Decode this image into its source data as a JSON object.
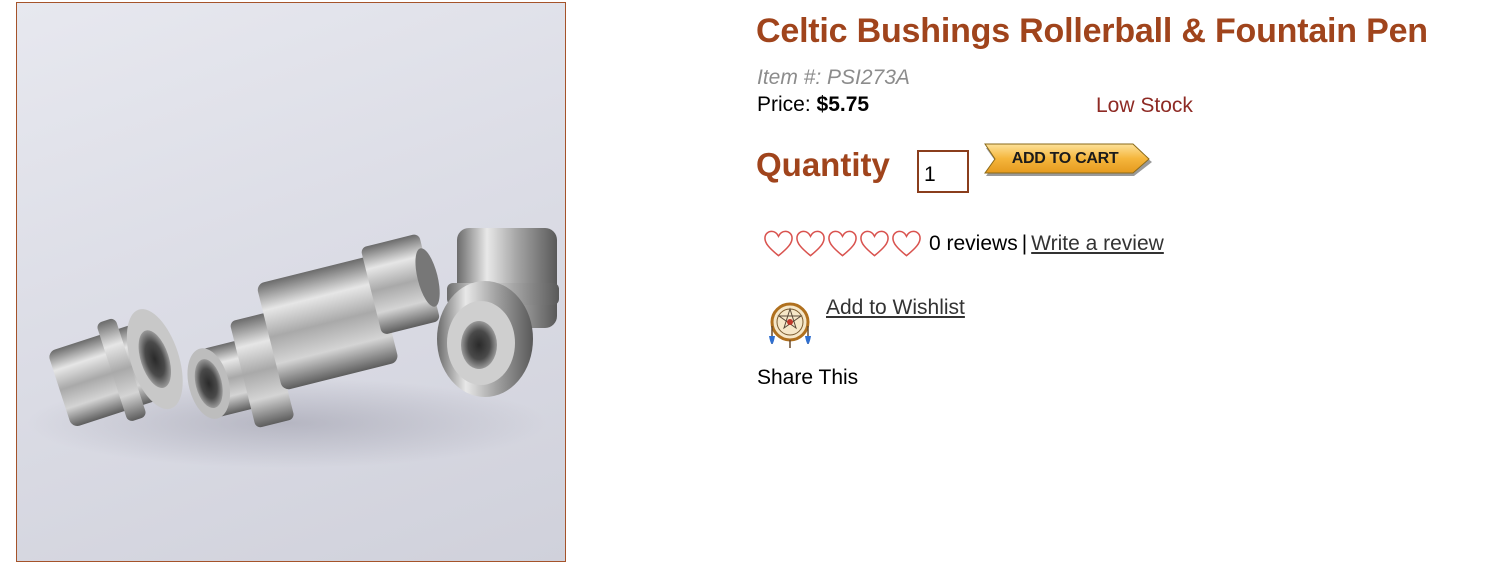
{
  "product": {
    "title": "Celtic Bushings Rollerball & Fountain Pen",
    "item_number": "Item #: PSI273A",
    "price_label": "Price:",
    "price_value": "$5.75",
    "stock_status": "Low Stock"
  },
  "purchase": {
    "quantity_label": "Quantity",
    "quantity_value": "1",
    "add_to_cart_label": "ADD TO CART"
  },
  "reviews": {
    "rating": 0,
    "max_rating": 5,
    "reviews_text": "0 reviews",
    "separator": "|",
    "write_review_label": "Write a review"
  },
  "wishlist": {
    "label": "Add to Wishlist",
    "icon": "dreamcatcher-icon"
  },
  "share": {
    "label": "Share This"
  },
  "colors": {
    "brand": "#a0441c",
    "stock": "#8e2a24",
    "image_border": "#a5532a",
    "heart": "#d9534f",
    "cart_button": "#f5b63c"
  }
}
